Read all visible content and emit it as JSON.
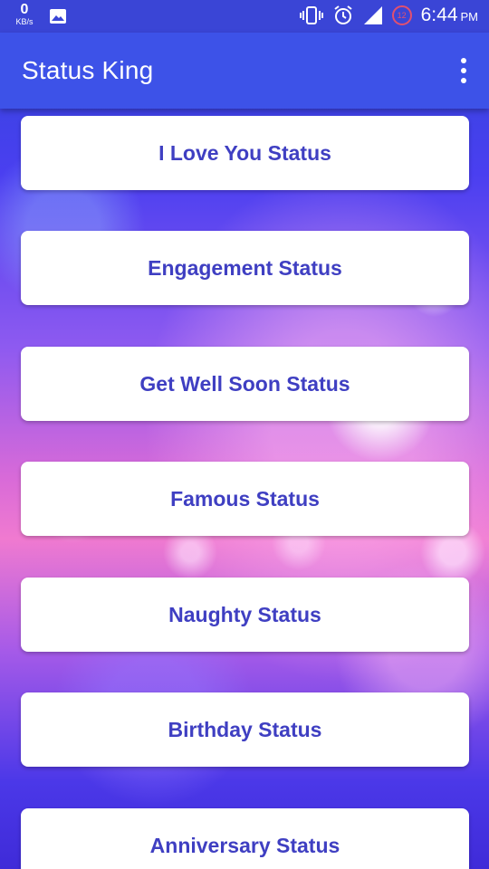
{
  "status_bar": {
    "net_speed_value": "0",
    "net_speed_unit": "KB/s",
    "notification_count": "12",
    "time": "6:44",
    "ampm": "PM"
  },
  "app_bar": {
    "title": "Status King"
  },
  "categories": [
    "I Love You Status",
    "Engagement Status",
    "Get Well Soon Status",
    "Famous Status",
    "Naughty Status",
    "Birthday Status",
    "Anniversary Status"
  ],
  "colors": {
    "app_bar": "#3d52e8",
    "status_bar": "#3a45d6",
    "card_text": "#3f3fc2",
    "card_bg": "#ffffff"
  }
}
